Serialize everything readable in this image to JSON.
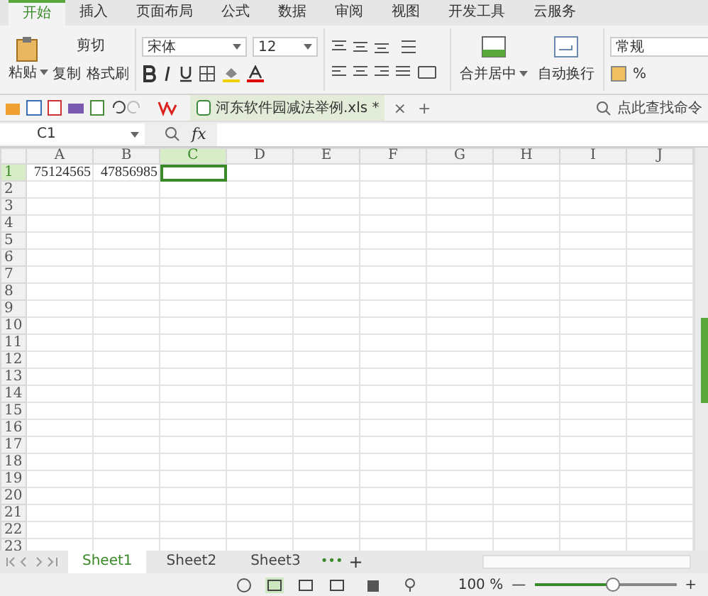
{
  "ribbon_tabs": [
    {
      "label": "开始",
      "selected": true
    },
    {
      "label": "插入",
      "selected": false
    },
    {
      "label": "页面布局",
      "selected": false
    },
    {
      "label": "公式",
      "selected": false
    },
    {
      "label": "数据",
      "selected": false
    },
    {
      "label": "审阅",
      "selected": false
    },
    {
      "label": "视图",
      "selected": false
    },
    {
      "label": "开发工具",
      "selected": false
    },
    {
      "label": "云服务",
      "selected": false
    }
  ],
  "clipboard": {
    "paste": "粘贴",
    "cut": "剪切",
    "copy": "复制",
    "format_painter": "格式刷"
  },
  "font": {
    "name": "宋体",
    "size": "12"
  },
  "alignment": {
    "merge": "合并居中",
    "wrap": "自动换行"
  },
  "number_format": {
    "value": "常规",
    "percent": "%"
  },
  "document_tab": {
    "label": "河东软件园减法举例.xls *",
    "close": "×",
    "add": "+"
  },
  "command_search": {
    "placeholder": "点此查找命令"
  },
  "formula_bar": {
    "name_box": "C1",
    "fx": "fx"
  },
  "sheet": {
    "columns": [
      {
        "label": "A",
        "selected": false
      },
      {
        "label": "B",
        "selected": false
      },
      {
        "label": "C",
        "selected": true
      },
      {
        "label": "D",
        "selected": false
      },
      {
        "label": "E",
        "selected": false
      },
      {
        "label": "F",
        "selected": false
      },
      {
        "label": "G",
        "selected": false
      },
      {
        "label": "H",
        "selected": false
      },
      {
        "label": "I",
        "selected": false
      },
      {
        "label": "J",
        "selected": false
      }
    ],
    "rows": [
      {
        "label": "1",
        "selected": true
      },
      {
        "label": "2",
        "selected": false
      },
      {
        "label": "3",
        "selected": false
      },
      {
        "label": "4",
        "selected": false
      },
      {
        "label": "5",
        "selected": false
      },
      {
        "label": "6",
        "selected": false
      },
      {
        "label": "7",
        "selected": false
      },
      {
        "label": "8",
        "selected": false
      },
      {
        "label": "9",
        "selected": false
      },
      {
        "label": "10",
        "selected": false
      },
      {
        "label": "11",
        "selected": false
      },
      {
        "label": "12",
        "selected": false
      },
      {
        "label": "13",
        "selected": false
      },
      {
        "label": "14",
        "selected": false
      },
      {
        "label": "15",
        "selected": false
      },
      {
        "label": "16",
        "selected": false
      },
      {
        "label": "17",
        "selected": false
      },
      {
        "label": "18",
        "selected": false
      },
      {
        "label": "19",
        "selected": false
      },
      {
        "label": "20",
        "selected": false
      },
      {
        "label": "21",
        "selected": false
      },
      {
        "label": "22",
        "selected": false
      },
      {
        "label": "23",
        "selected": false
      }
    ],
    "cells": [
      [
        "75124565",
        "47856985"
      ]
    ]
  },
  "sheet_tabs": [
    {
      "label": "Sheet1",
      "selected": true
    },
    {
      "label": "Sheet2",
      "selected": false
    },
    {
      "label": "Sheet3",
      "selected": false
    }
  ],
  "sheet_tab_more": "•••",
  "sheet_tab_add": "+",
  "status_bar": {
    "zoom": "100 %",
    "zoom_minus": "—",
    "zoom_plus": "+",
    "level": 0.55
  }
}
